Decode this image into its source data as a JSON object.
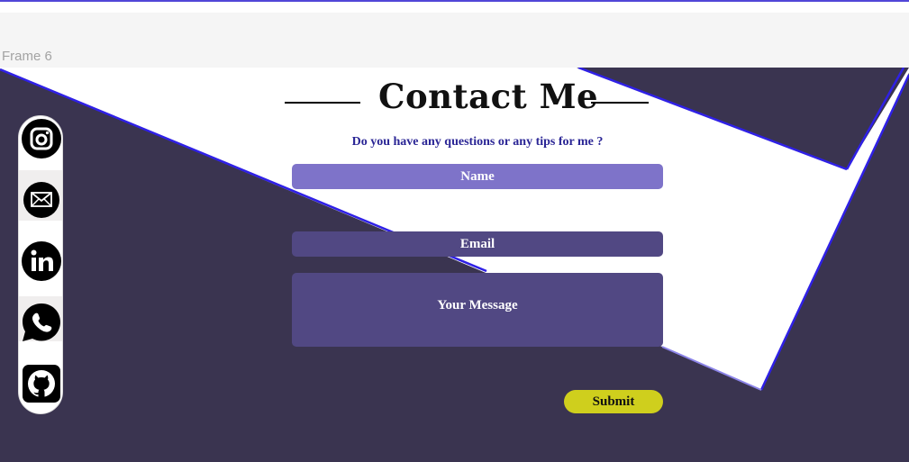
{
  "canvas": {
    "frame_label": "Frame 6"
  },
  "header": {
    "title": "Contact Me",
    "subtitle": "Do you have any questions or any tips for me ?"
  },
  "form": {
    "name_placeholder": "Name",
    "email_placeholder": "Email",
    "message_placeholder": "Your Message",
    "submit_label": "Submit"
  },
  "social": [
    "instagram-icon",
    "mail-icon",
    "linkedin-icon",
    "whatsapp-icon",
    "github-icon"
  ],
  "colors": {
    "frame_bg": "#3a3450",
    "accent_blue": "#2f20e6",
    "name_field": "#7e73c9",
    "field": "#514883",
    "submit": "#cfcf1d",
    "subtitle": "#2a2595"
  }
}
